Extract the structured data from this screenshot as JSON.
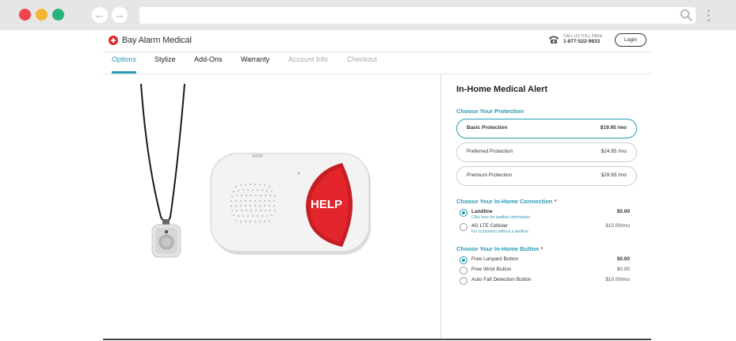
{
  "browser": {
    "back_icon": "arrow-left-icon",
    "forward_icon": "arrow-right-icon",
    "search_icon": "search-icon",
    "menu_icon": "kebab-menu-icon"
  },
  "header": {
    "brand": "Bay Alarm Medical",
    "toll_free_label": "CALL US TOLL FREE:",
    "phone": "1-877-522-9633",
    "login_label": "Login"
  },
  "tabs": [
    {
      "label": "Options",
      "state": "active"
    },
    {
      "label": "Stylize",
      "state": "enabled"
    },
    {
      "label": "Add-Ons",
      "state": "enabled"
    },
    {
      "label": "Warranty",
      "state": "enabled"
    },
    {
      "label": "Account Info",
      "state": "disabled"
    },
    {
      "label": "Checkout",
      "state": "disabled"
    }
  ],
  "product": {
    "title": "In-Home Medical Alert",
    "device_button_text": "HELP"
  },
  "protection": {
    "heading": "Choose Your Protection",
    "options": [
      {
        "label": "Basic Protection",
        "price": "$19.95 /mo",
        "selected": true
      },
      {
        "label": "Preferred Protection",
        "price": "$24.95 /mo",
        "selected": false
      },
      {
        "label": "Premium Protection",
        "price": "$29.95 /mo",
        "selected": false
      }
    ]
  },
  "connection": {
    "heading": "Choose Your In-Home Connection",
    "required_mark": "*",
    "options": [
      {
        "label": "Landline",
        "sub": "Click here for landline information",
        "price": "$0.00",
        "selected": true
      },
      {
        "label": "4G LTE Cellular",
        "sub": "For customers without a landline",
        "price": "$10.00/mo",
        "selected": false
      }
    ]
  },
  "button": {
    "heading": "Choose Your In-Home Button",
    "required_mark": "*",
    "options": [
      {
        "label": "Free Lanyard Button",
        "price": "$0.00",
        "selected": true
      },
      {
        "label": "Free Wrist Button",
        "price": "$0.00",
        "selected": false
      },
      {
        "label": "Auto Fall Detection Button",
        "price": "$10.00/mo",
        "selected": false
      }
    ]
  },
  "colors": {
    "accent": "#2a9bb5",
    "brand_red": "#d92a2a",
    "help_red": "#e3262c"
  }
}
